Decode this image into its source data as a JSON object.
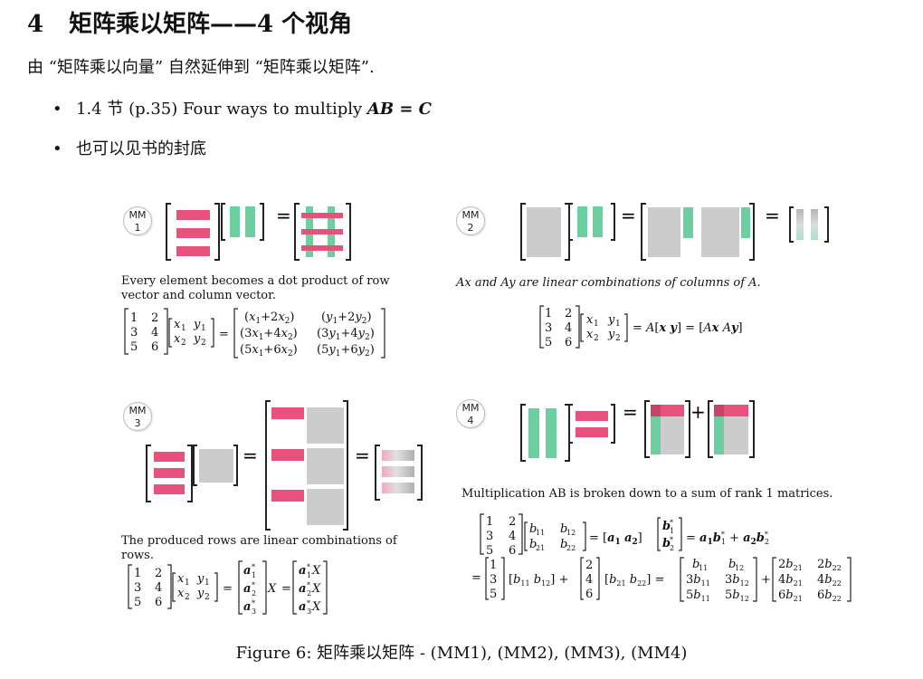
{
  "section": {
    "number": "4",
    "title": "矩阵乘以矩阵——4 个视角"
  },
  "intro": "由 “矩阵乘以向量” 自然延伸到 “矩阵乘以矩阵”.",
  "bullets": [
    {
      "text": "1.4 节 (p.35) Four ways to multiply ",
      "math": "AB = C"
    },
    {
      "text": "也可以见书的封底"
    }
  ],
  "panels": [
    {
      "badge": [
        "MM",
        "1"
      ],
      "caption": "Every element becomes a dot product of row vector and column vector."
    },
    {
      "badge": [
        "MM",
        "2"
      ],
      "caption": "Ax and Ay  are linear combinations of columns of A."
    },
    {
      "badge": [
        "MM",
        "3"
      ],
      "caption": "The produced rows are linear combinations of rows."
    },
    {
      "badge": [
        "MM",
        "4"
      ],
      "caption": "Multiplication AB is broken down to a sum of rank 1 matrices."
    }
  ],
  "figure_caption": "Figure 6: 矩阵乘以矩阵 - (MM1), (MM2), (MM3), (MM4)",
  "colors": {
    "row": "#e8517c",
    "col": "#6ccfa0",
    "block": "#cccccc"
  }
}
